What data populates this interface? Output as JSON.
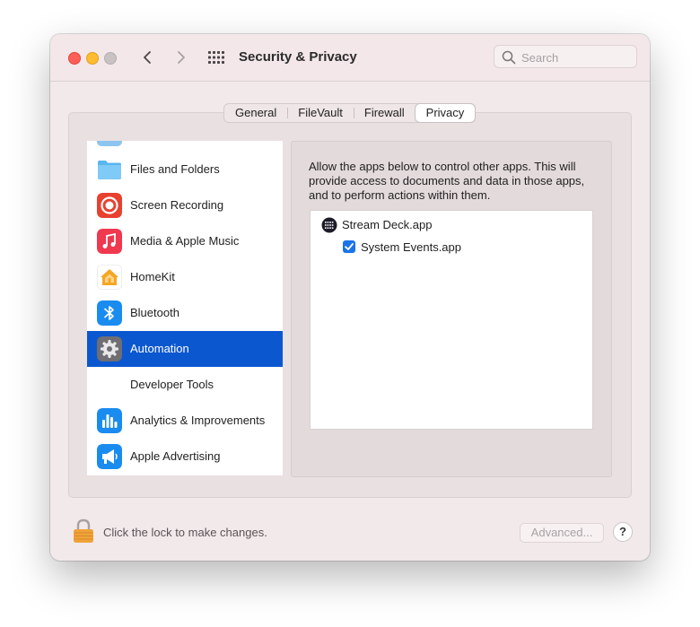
{
  "window": {
    "title": "Security & Privacy",
    "search_placeholder": "Search"
  },
  "tabs": [
    {
      "label": "General",
      "selected": false
    },
    {
      "label": "FileVault",
      "selected": false
    },
    {
      "label": "Firewall",
      "selected": false
    },
    {
      "label": "Privacy",
      "selected": true
    }
  ],
  "sidebar": {
    "items": [
      {
        "label": "Files and Folders",
        "icon": "folder-icon"
      },
      {
        "label": "Screen Recording",
        "icon": "screen-recording-icon"
      },
      {
        "label": "Media & Apple Music",
        "icon": "music-icon"
      },
      {
        "label": "HomeKit",
        "icon": "homekit-icon"
      },
      {
        "label": "Bluetooth",
        "icon": "bluetooth-icon"
      },
      {
        "label": "Automation",
        "icon": "gear-icon",
        "selected": true
      },
      {
        "label": "Developer Tools",
        "icon": ""
      },
      {
        "label": "Analytics & Improvements",
        "icon": "analytics-icon"
      },
      {
        "label": "Apple Advertising",
        "icon": "megaphone-icon"
      }
    ]
  },
  "content": {
    "description": "Allow the apps below to control other apps. This will provide access to documents and data in those apps, and to perform actions within them.",
    "apps": [
      {
        "name": "Stream Deck.app",
        "icon": "stream-deck-icon"
      },
      {
        "name": "System Events.app",
        "checked": true
      }
    ]
  },
  "footer": {
    "lock_text": "Click the lock to make changes.",
    "advanced_label": "Advanced...",
    "help_label": "?"
  },
  "colors": {
    "selection": "#0b57d0",
    "window_bg": "#f2e9ea",
    "checkbox": "#1a73e8"
  }
}
